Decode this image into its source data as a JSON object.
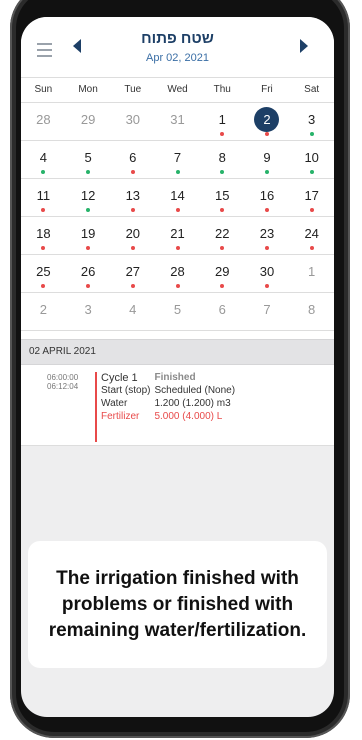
{
  "header": {
    "title": "שטח פתוח",
    "date": "Apr 02, 2021"
  },
  "weekdays": [
    "Sun",
    "Mon",
    "Tue",
    "Wed",
    "Thu",
    "Fri",
    "Sat"
  ],
  "calendar": {
    "status_colors": {
      "red": "#e84a4a",
      "green": "#27b36a"
    },
    "weeks": [
      [
        {
          "d": "28",
          "out": true
        },
        {
          "d": "29",
          "out": true
        },
        {
          "d": "30",
          "out": true
        },
        {
          "d": "31",
          "out": true
        },
        {
          "d": "1",
          "dot": "red"
        },
        {
          "d": "2",
          "dot": "red",
          "sel": true
        },
        {
          "d": "3",
          "dot": "green"
        }
      ],
      [
        {
          "d": "4",
          "dot": "green"
        },
        {
          "d": "5",
          "dot": "green"
        },
        {
          "d": "6",
          "dot": "red"
        },
        {
          "d": "7",
          "dot": "green"
        },
        {
          "d": "8",
          "dot": "green"
        },
        {
          "d": "9",
          "dot": "green"
        },
        {
          "d": "10",
          "dot": "green"
        }
      ],
      [
        {
          "d": "11",
          "dot": "red"
        },
        {
          "d": "12",
          "dot": "green"
        },
        {
          "d": "13",
          "dot": "red"
        },
        {
          "d": "14",
          "dot": "red"
        },
        {
          "d": "15",
          "dot": "red"
        },
        {
          "d": "16",
          "dot": "red"
        },
        {
          "d": "17",
          "dot": "red"
        }
      ],
      [
        {
          "d": "18",
          "dot": "red"
        },
        {
          "d": "19",
          "dot": "red"
        },
        {
          "d": "20",
          "dot": "red"
        },
        {
          "d": "21",
          "dot": "red"
        },
        {
          "d": "22",
          "dot": "red"
        },
        {
          "d": "23",
          "dot": "red"
        },
        {
          "d": "24",
          "dot": "red"
        }
      ],
      [
        {
          "d": "25",
          "dot": "red"
        },
        {
          "d": "26",
          "dot": "red"
        },
        {
          "d": "27",
          "dot": "red"
        },
        {
          "d": "28",
          "dot": "red"
        },
        {
          "d": "29",
          "dot": "red"
        },
        {
          "d": "30",
          "dot": "red"
        },
        {
          "d": "1",
          "out": true
        }
      ],
      [
        {
          "d": "2",
          "out": true
        },
        {
          "d": "3",
          "out": true
        },
        {
          "d": "4",
          "out": true
        },
        {
          "d": "5",
          "out": true
        },
        {
          "d": "6",
          "out": true
        },
        {
          "d": "7",
          "out": true
        },
        {
          "d": "8",
          "out": true
        }
      ]
    ]
  },
  "details": {
    "section_title": "02 APRIL 2021",
    "start_time": "06:00:00",
    "end_time": "06:12:04",
    "cycle_label": "Cycle 1",
    "cycle_status": "Finished",
    "start_label": "Start (stop)",
    "start_value": "Scheduled (None)",
    "water_label": "Water",
    "water_value": "1.200 (1.200) m3",
    "fert_label": "Fertilizer",
    "fert_value": "5.000 (4.000) L"
  },
  "note": "The irrigation finished with problems or finished with remaining water/fertilization."
}
